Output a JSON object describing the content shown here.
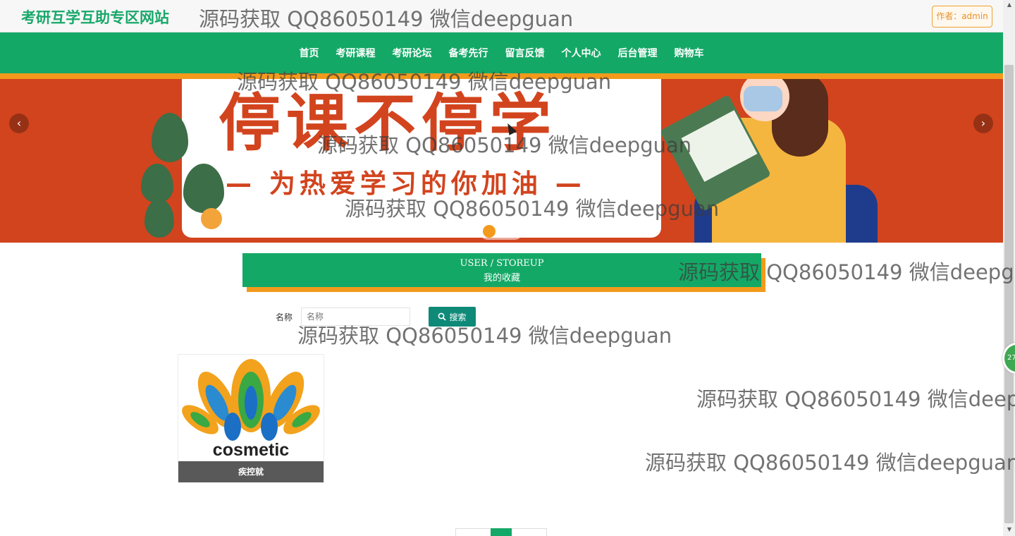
{
  "header": {
    "site_title": "考研互学互助专区网站",
    "author_label": "作者：admin"
  },
  "nav": {
    "items": [
      "首页",
      "考研课程",
      "考研论坛",
      "备考先行",
      "留言反馈",
      "个人中心",
      "后台管理",
      "购物车"
    ]
  },
  "banner": {
    "headline": "停课不停学",
    "subline": "— 为热爱学习的你加油 —",
    "prev_icon": "chevron-left-icon",
    "next_icon": "chevron-right-icon",
    "slide_count": 3,
    "active_slide": 1
  },
  "section": {
    "title_en": "USER / STOREUP",
    "title_cn": "我的收藏"
  },
  "search": {
    "label": "名称",
    "placeholder": "名称",
    "button_label": "搜索",
    "button_icon": "search-icon"
  },
  "favorites": [
    {
      "name": "疾控就",
      "image_text": "cosmetic"
    }
  ],
  "side_widget": {
    "text": "27"
  },
  "watermark": "源码获取 QQ86050149 微信deepguan",
  "colors": {
    "brand_green": "#14a866",
    "accent_orange": "#f39a1c",
    "banner_red": "#d2441e",
    "search_teal": "#0f8a78"
  }
}
